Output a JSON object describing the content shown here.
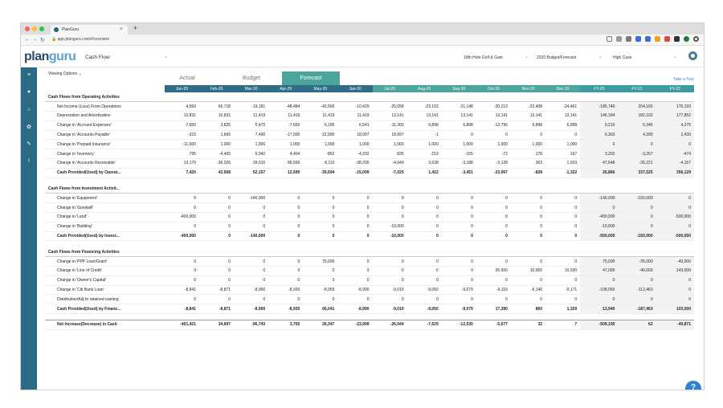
{
  "browser": {
    "tab_title": "PlanGuru",
    "url": "app.planguru.com/#/scenario"
  },
  "app": {
    "logo_a": "plan",
    "logo_b": "guru",
    "module": "Cash Flow",
    "header_selects": [
      "19th Hole Golf & Gam",
      "2020 Budget/Forecast",
      "High Case"
    ]
  },
  "view": {
    "viewing_options": "Viewing Options",
    "tabs": [
      "Actual",
      "Budget",
      "Forecast"
    ],
    "take_tour": "Take a Tour",
    "help": "?"
  },
  "columns": [
    "Jan-20",
    "Feb-20",
    "Mar-20",
    "Apr-20",
    "May-20",
    "Jun-20",
    "Jul-20",
    "Aug-20",
    "Sep-20",
    "Oct-20",
    "Nov-20",
    "Dec-20",
    "FY-20",
    "FY-21",
    "FY-22"
  ],
  "rows": [
    {
      "type": "sec",
      "label": "Cash Flows from Operating Activities",
      "v": [
        "",
        "",
        "",
        "",
        "",
        "",
        "",
        "",
        "",
        "",
        "",
        "",
        "",
        "",
        ""
      ]
    },
    {
      "type": "row",
      "label": "Net Income (Loss) From Operations",
      "v": [
        "4,569",
        "66,718",
        "-19,181",
        "-48,484",
        "-42,566",
        "-10,429",
        "-25,058",
        "-23,102",
        "-21,148",
        "-20,213",
        "-22,408",
        "-24,461",
        "-185,740",
        "204,165",
        "176,193"
      ]
    },
    {
      "type": "row",
      "label": "Depreciation and Amortization",
      "v": [
        "10,831",
        "10,831",
        "11,419",
        "11,419",
        "11,419",
        "11,419",
        "13,141",
        "13,141",
        "13,141",
        "13,141",
        "13,141",
        "13,141",
        "146,184",
        "182,102",
        "177,852"
      ]
    },
    {
      "type": "row",
      "label": "Change in 'Accrued Expenses'",
      "v": [
        "-7,650",
        "3,825",
        "5,472",
        "-7,650",
        "6,185",
        "6,541",
        "-11,300",
        "6,898",
        "6,898",
        "-13,796",
        "6,898",
        "6,898",
        "9,210",
        "5,346",
        "4,275"
      ]
    },
    {
      "type": "row",
      "label": "Change in 'Accounts Payable'",
      "v": [
        "-315",
        "1,665",
        "7,490",
        "-17,500",
        "-22,990",
        "18,997",
        "18,997",
        "-1",
        "0",
        "0",
        "0",
        "0",
        "6,363",
        "4,399",
        "2,439"
      ]
    },
    {
      "type": "row",
      "label": "Change in 'Prepaid Insurance'",
      "v": [
        "-11,000",
        "1,000",
        "1,000",
        "1,000",
        "1,000",
        "1,000",
        "1,000",
        "1,000",
        "1,000",
        "1,000",
        "1,000",
        "1,000",
        "0",
        "0",
        "0"
      ]
    },
    {
      "type": "row",
      "label": "Change in 'Inventory'",
      "v": [
        "795",
        "-4,465",
        "6,942",
        "4,404",
        "-852",
        "-4,332",
        "835",
        "-153",
        "-155",
        "-72",
        "178",
        "167",
        "3,292",
        "-3,267",
        "-474"
      ]
    },
    {
      "type": "row",
      "label": "Change in 'Accounts Receivable'",
      "v": [
        "10,170",
        "-36,026",
        "39,015",
        "89,506",
        "8,110",
        "-38,205",
        "-4,640",
        "3,638",
        "-3,188",
        "-3,128",
        "363",
        "1,933",
        "47,548",
        "-35,221",
        "-4,157"
      ]
    },
    {
      "type": "tot",
      "label": "Cash Provided(Used) by Operat...",
      "v": [
        "7,420",
        "43,568",
        "52,157",
        "12,695",
        "-39,694",
        "-15,009",
        "-7,025",
        "1,422",
        "-3,451",
        "-23,067",
        "-828",
        "-1,322",
        "26,866",
        "337,525",
        "356,129"
      ]
    },
    {
      "type": "gap",
      "label": "",
      "v": [
        "",
        "",
        "",
        "",
        "",
        "",
        "",
        "",
        "",
        "",
        "",
        "",
        "",
        "",
        ""
      ]
    },
    {
      "type": "sec",
      "label": "Cash Flows from Investment Activit...",
      "v": [
        "",
        "",
        "",
        "",
        "",
        "",
        "",
        "",
        "",
        "",
        "",
        "",
        "",
        "",
        ""
      ]
    },
    {
      "type": "row",
      "label": "Change in 'Equipment'",
      "v": [
        "0",
        "0",
        "-140,000",
        "0",
        "0",
        "0",
        "0",
        "0",
        "0",
        "0",
        "0",
        "0",
        "-140,000",
        "-150,000",
        "0"
      ]
    },
    {
      "type": "row",
      "label": "Change in 'Goodwill'",
      "v": [
        "0",
        "0",
        "0",
        "0",
        "0",
        "0",
        "0",
        "0",
        "0",
        "0",
        "0",
        "0",
        "0",
        "0",
        "0"
      ]
    },
    {
      "type": "row",
      "label": "Change in 'Land'",
      "v": [
        "-400,000",
        "0",
        "0",
        "0",
        "0",
        "0",
        "0",
        "0",
        "0",
        "0",
        "0",
        "0",
        "-400,000",
        "0",
        "-500,000"
      ]
    },
    {
      "type": "row",
      "label": "Change in 'Building'",
      "v": [
        "0",
        "0",
        "0",
        "0",
        "0",
        "0",
        "-10,000",
        "0",
        "0",
        "0",
        "0",
        "0",
        "-10,000",
        "0",
        "0"
      ]
    },
    {
      "type": "tot",
      "label": "Cash Provided(Used) by Invest...",
      "v": [
        "-400,000",
        "0",
        "-140,000",
        "0",
        "0",
        "0",
        "-10,000",
        "0",
        "0",
        "0",
        "0",
        "0",
        "-550,000",
        "-150,000",
        "-500,000"
      ]
    },
    {
      "type": "gap",
      "label": "",
      "v": [
        "",
        "",
        "",
        "",
        "",
        "",
        "",
        "",
        "",
        "",
        "",
        "",
        "",
        "",
        ""
      ]
    },
    {
      "type": "sec",
      "label": "Cash Flows from Financing Activities",
      "v": [
        "",
        "",
        "",
        "",
        "",
        "",
        "",
        "",
        "",
        "",
        "",
        "",
        "",
        "",
        ""
      ]
    },
    {
      "type": "row",
      "label": "Change in 'PPP Loan/Grant'",
      "v": [
        "0",
        "0",
        "0",
        "0",
        "75,000",
        "0",
        "0",
        "0",
        "0",
        "0",
        "0",
        "0",
        "75,000",
        "-35,000",
        "-40,000"
      ]
    },
    {
      "type": "row",
      "label": "Change in 'Line of Credit'",
      "v": [
        "0",
        "0",
        "0",
        "0",
        "0",
        "0",
        "0",
        "0",
        "0",
        "26,500",
        "10,000",
        "10,500",
        "47,000",
        "-40,000",
        "143,000"
      ]
    },
    {
      "type": "row",
      "label": "Change in 'Owner's Capital'",
      "v": [
        "0",
        "0",
        "0",
        "0",
        "0",
        "0",
        "0",
        "0",
        "0",
        "0",
        "0",
        "0",
        "0",
        "0",
        "0"
      ]
    },
    {
      "type": "row",
      "label": "Change in 'Citi Bank Loan'",
      "v": [
        "-8,841",
        "-8,871",
        "-8,900",
        "-8,930",
        "-8,959",
        "-8,990",
        "-9,019",
        "-9,050",
        "-9,079",
        "-9,110",
        "-9,140",
        "-9,171",
        "-108,060",
        "-112,463",
        "0"
      ]
    },
    {
      "type": "row",
      "label": "Distribution/Adj to retained earning",
      "v": [
        "0",
        "0",
        "0",
        "0",
        "0",
        "0",
        "0",
        "0",
        "0",
        "0",
        "0",
        "0",
        "0",
        "0",
        "0"
      ]
    },
    {
      "type": "tot",
      "label": "Cash Provided(Used) by Financ...",
      "v": [
        "-8,841",
        "-8,871",
        "-8,900",
        "-8,930",
        "66,041",
        "-8,990",
        "-9,019",
        "-9,050",
        "-9,079",
        "17,390",
        "860",
        "1,329",
        "13,940",
        "-187,463",
        "103,000"
      ]
    },
    {
      "type": "gap",
      "label": "",
      "v": [
        "",
        "",
        "",
        "",
        "",
        "",
        "",
        "",
        "",
        "",
        "",
        "",
        "",
        "",
        ""
      ]
    },
    {
      "type": "tot",
      "label": "Net Increase(Decrease) in Cash",
      "v": [
        "-401,421",
        "34,697",
        "-96,743",
        "3,765",
        "26,347",
        "-23,999",
        "-26,044",
        "-7,629",
        "-12,530",
        "-5,677",
        "32",
        "7",
        "-509,195",
        "62",
        "-40,871"
      ]
    }
  ]
}
